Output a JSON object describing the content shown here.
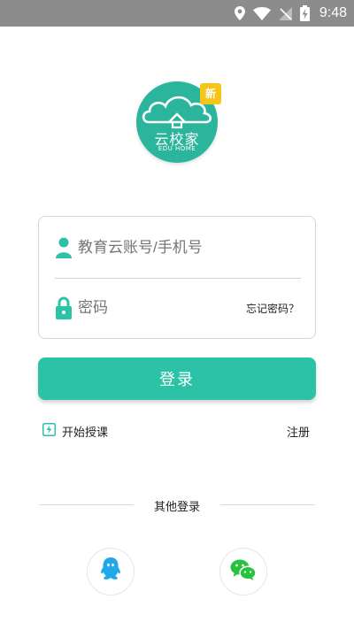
{
  "status_bar": {
    "time": "9:48"
  },
  "logo": {
    "name": "云校家",
    "subtitle": "EDU HOME",
    "badge": "新",
    "color": "#2bb59c"
  },
  "login_form": {
    "account_placeholder": "教育云账号/手机号",
    "password_placeholder": "密码",
    "forgot_password": "忘记密码？"
  },
  "login_button": {
    "label": "登录",
    "color": "#2cc2a7"
  },
  "links": {
    "start_lesson": "开始授课",
    "register": "注册"
  },
  "other_login": {
    "label": "其他登录"
  },
  "theme": {
    "accent": "#2cc2a7"
  }
}
